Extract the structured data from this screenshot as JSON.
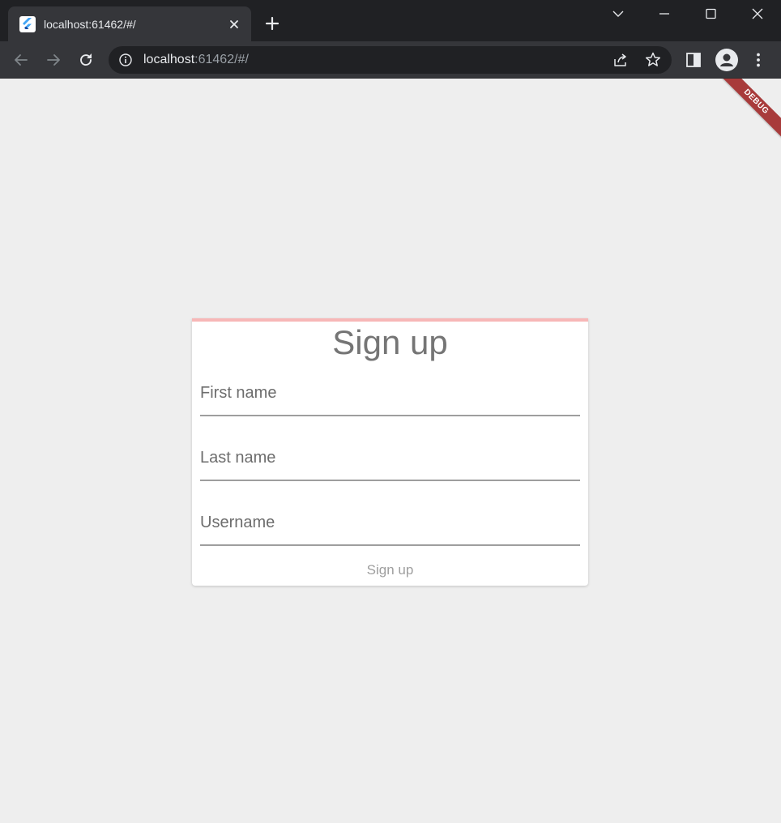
{
  "browser": {
    "tab": {
      "title": "localhost:61462/#/",
      "favicon": "flutter-icon"
    },
    "address_bar": {
      "host": "localhost",
      "path": ":61462/#/"
    },
    "colors": {
      "titlebar": "#202124",
      "toolbar": "#35363a",
      "omnibox": "#202124"
    }
  },
  "page": {
    "debug_banner": "DEBUG",
    "form": {
      "title": "Sign up",
      "progress_color": "#f7b7b7",
      "fields": [
        {
          "placeholder": "First name",
          "value": ""
        },
        {
          "placeholder": "Last name",
          "value": ""
        },
        {
          "placeholder": "Username",
          "value": ""
        }
      ],
      "submit_label": "Sign up"
    }
  }
}
